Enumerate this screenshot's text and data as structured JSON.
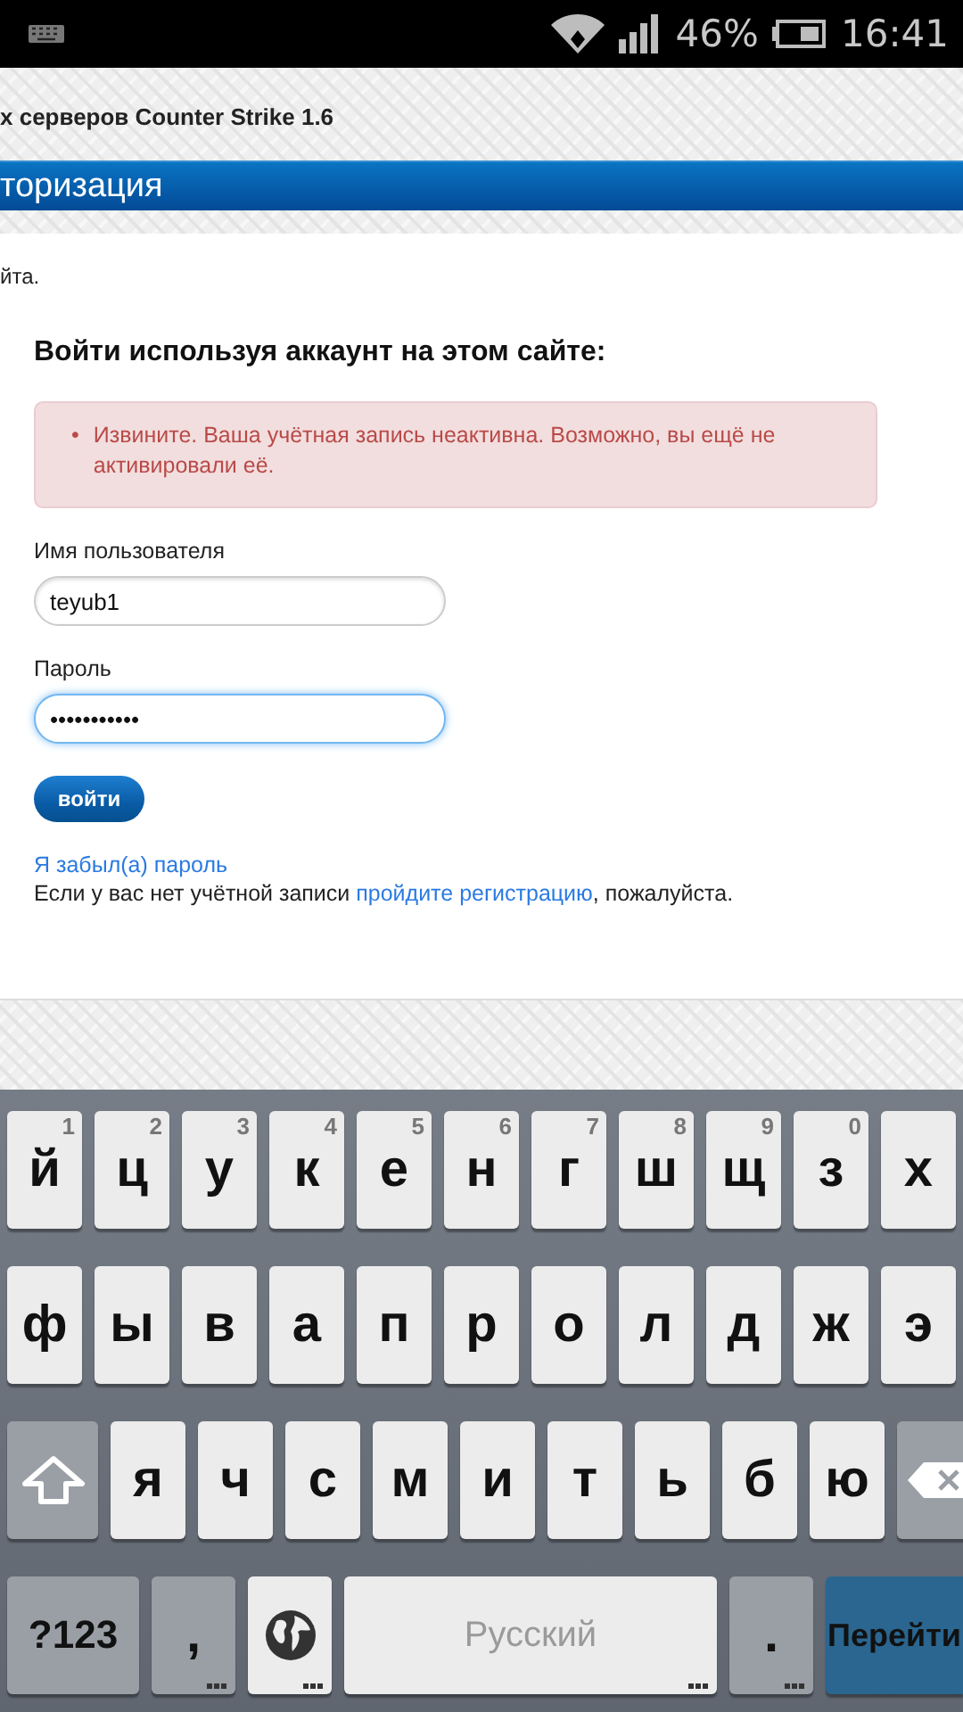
{
  "status_bar": {
    "battery_percent": "46%",
    "time": "16:41"
  },
  "site_header": {
    "title": "х серверов Counter Strike 1.6"
  },
  "page_title": "торизация",
  "intro_text": "йта.",
  "login": {
    "heading": "Войти используя аккаунт на этом сайте:",
    "errors": [
      {
        "bullet": "•",
        "text": "Извините. Ваша учётная запись неактивна. Возможно, вы ещё не активировали её."
      }
    ],
    "fields": [
      {
        "label": "Имя пользователя",
        "value": "teyub1",
        "focused": false
      },
      {
        "label": "Пароль",
        "value": "•••••••••••",
        "focused": true
      }
    ],
    "submit": "войти",
    "forgot_link": "Я забыл(а) пароль",
    "register": {
      "before": "Если у вас нет учётной записи ",
      "link": "пройдите регистрацию",
      "after": ", пожалуйста."
    }
  },
  "keyboard": {
    "letter_rows": [
      [
        {
          "kind": "letter",
          "label": "й",
          "hint": "1"
        },
        {
          "kind": "letter",
          "label": "ц",
          "hint": "2"
        },
        {
          "kind": "letter",
          "label": "у",
          "hint": "3"
        },
        {
          "kind": "letter",
          "label": "к",
          "hint": "4"
        },
        {
          "kind": "letter",
          "label": "е",
          "hint": "5"
        },
        {
          "kind": "letter",
          "label": "н",
          "hint": "6"
        },
        {
          "kind": "letter",
          "label": "г",
          "hint": "7"
        },
        {
          "kind": "letter",
          "label": "ш",
          "hint": "8"
        },
        {
          "kind": "letter",
          "label": "щ",
          "hint": "9"
        },
        {
          "kind": "letter",
          "label": "з",
          "hint": "0"
        },
        {
          "kind": "letter",
          "label": "х"
        }
      ],
      [
        {
          "kind": "letter",
          "label": "ф"
        },
        {
          "kind": "letter",
          "label": "ы"
        },
        {
          "kind": "letter",
          "label": "в"
        },
        {
          "kind": "letter",
          "label": "а"
        },
        {
          "kind": "letter",
          "label": "п"
        },
        {
          "kind": "letter",
          "label": "р"
        },
        {
          "kind": "letter",
          "label": "о"
        },
        {
          "kind": "letter",
          "label": "л"
        },
        {
          "kind": "letter",
          "label": "д"
        },
        {
          "kind": "letter",
          "label": "ж"
        },
        {
          "kind": "letter",
          "label": "э"
        }
      ],
      [
        {
          "kind": "shift"
        },
        {
          "kind": "letter",
          "label": "я"
        },
        {
          "kind": "letter",
          "label": "ч"
        },
        {
          "kind": "letter",
          "label": "с"
        },
        {
          "kind": "letter",
          "label": "м"
        },
        {
          "kind": "letter",
          "label": "и"
        },
        {
          "kind": "letter",
          "label": "т"
        },
        {
          "kind": "letter",
          "label": "ь"
        },
        {
          "kind": "letter",
          "label": "б"
        },
        {
          "kind": "letter",
          "label": "ю"
        },
        {
          "kind": "backspace"
        }
      ]
    ],
    "bottom_row": [
      {
        "kind": "symbols",
        "label": "?123"
      },
      {
        "kind": "punct",
        "label": ",",
        "more": true
      },
      {
        "kind": "globe",
        "more": true
      },
      {
        "kind": "space",
        "label": "Русский",
        "more": true
      },
      {
        "kind": "punct",
        "label": ".",
        "more": true
      },
      {
        "kind": "go",
        "label": "Перейти"
      }
    ]
  }
}
